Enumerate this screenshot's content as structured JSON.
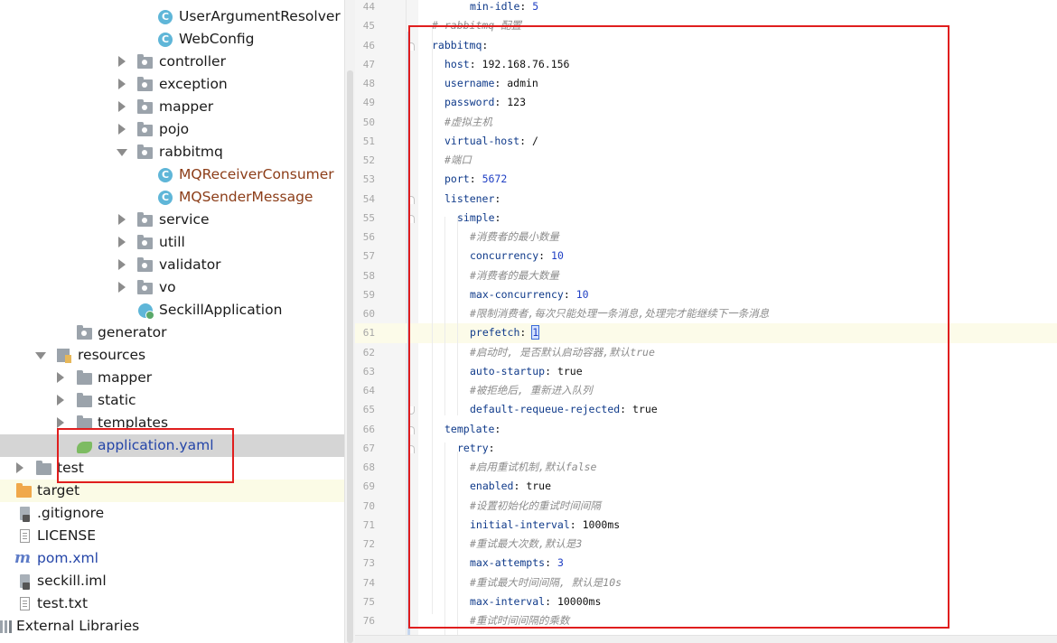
{
  "project_tree": {
    "items": [
      {
        "label": "UserArgumentResolver",
        "icon": "class-icon"
      },
      {
        "label": "WebConfig",
        "icon": "class-icon"
      },
      {
        "label": "controller",
        "icon": "package-folder-icon",
        "expanded": false
      },
      {
        "label": "exception",
        "icon": "package-folder-icon",
        "expanded": false
      },
      {
        "label": "mapper",
        "icon": "package-folder-icon",
        "expanded": false
      },
      {
        "label": "pojo",
        "icon": "package-folder-icon",
        "expanded": false
      },
      {
        "label": "rabbitmq",
        "icon": "package-folder-icon",
        "expanded": true
      },
      {
        "label": "MQReceiverConsumer",
        "icon": "class-icon"
      },
      {
        "label": "MQSenderMessage",
        "icon": "class-icon"
      },
      {
        "label": "service",
        "icon": "package-folder-icon",
        "expanded": false
      },
      {
        "label": "utill",
        "icon": "package-folder-icon",
        "expanded": false
      },
      {
        "label": "validator",
        "icon": "package-folder-icon",
        "expanded": false
      },
      {
        "label": "vo",
        "icon": "package-folder-icon",
        "expanded": false
      },
      {
        "label": "SeckillApplication",
        "icon": "spring-app-icon"
      },
      {
        "label": "generator",
        "icon": "package-folder-icon"
      },
      {
        "label": "resources",
        "icon": "resources-folder-icon",
        "expanded": true
      },
      {
        "label": "mapper",
        "icon": "folder-icon",
        "expanded": false
      },
      {
        "label": "static",
        "icon": "folder-icon",
        "expanded": false
      },
      {
        "label": "templates",
        "icon": "folder-icon",
        "expanded": false
      },
      {
        "label": "application.yaml",
        "icon": "yaml-file-icon",
        "selected": true
      },
      {
        "label": "test",
        "icon": "folder-icon",
        "expanded": false
      },
      {
        "label": "target",
        "icon": "excluded-folder-icon",
        "expanded": false
      },
      {
        "label": ".gitignore",
        "icon": "gitignore-file-icon"
      },
      {
        "label": "LICENSE",
        "icon": "text-file-icon"
      },
      {
        "label": "pom.xml",
        "icon": "maven-icon"
      },
      {
        "label": "seckill.iml",
        "icon": "iml-file-icon"
      },
      {
        "label": "test.txt",
        "icon": "text-file-icon"
      },
      {
        "label": "External Libraries",
        "icon": "libraries-icon"
      }
    ]
  },
  "editor": {
    "file": "application.yaml",
    "current_line": 61,
    "lines": [
      {
        "no": "44",
        "parts": [
          {
            "t": "k",
            "s": "min-idle"
          },
          {
            "t": "v",
            "s": ": "
          },
          {
            "t": "n",
            "s": "5"
          }
        ]
      },
      {
        "no": "45",
        "parts": [
          {
            "t": "c",
            "s": "# rabbitmq 配置"
          }
        ]
      },
      {
        "no": "46",
        "parts": [
          {
            "t": "k",
            "s": "rabbitmq"
          },
          {
            "t": "v",
            "s": ":"
          }
        ]
      },
      {
        "no": "47",
        "parts": [
          {
            "t": "k",
            "s": "host"
          },
          {
            "t": "v",
            "s": ": 192.168.76.156"
          }
        ]
      },
      {
        "no": "48",
        "parts": [
          {
            "t": "k",
            "s": "username"
          },
          {
            "t": "v",
            "s": ": admin"
          }
        ]
      },
      {
        "no": "49",
        "parts": [
          {
            "t": "k",
            "s": "password"
          },
          {
            "t": "v",
            "s": ": "
          },
          {
            "t": "v",
            "s": "123"
          }
        ]
      },
      {
        "no": "50",
        "parts": [
          {
            "t": "c",
            "s": "#虚拟主机"
          }
        ]
      },
      {
        "no": "51",
        "parts": [
          {
            "t": "k",
            "s": "virtual-host"
          },
          {
            "t": "v",
            "s": ": /"
          }
        ]
      },
      {
        "no": "52",
        "parts": [
          {
            "t": "c",
            "s": "#端口"
          }
        ]
      },
      {
        "no": "53",
        "parts": [
          {
            "t": "k",
            "s": "port"
          },
          {
            "t": "v",
            "s": ": "
          },
          {
            "t": "n",
            "s": "5672"
          }
        ]
      },
      {
        "no": "54",
        "parts": [
          {
            "t": "k",
            "s": "listener"
          },
          {
            "t": "v",
            "s": ":"
          }
        ]
      },
      {
        "no": "55",
        "parts": [
          {
            "t": "k",
            "s": "simple"
          },
          {
            "t": "v",
            "s": ":"
          }
        ]
      },
      {
        "no": "56",
        "parts": [
          {
            "t": "c",
            "s": "#消费者的最小数量"
          }
        ]
      },
      {
        "no": "57",
        "parts": [
          {
            "t": "k",
            "s": "concurrency"
          },
          {
            "t": "v",
            "s": ": "
          },
          {
            "t": "n",
            "s": "10"
          }
        ]
      },
      {
        "no": "58",
        "parts": [
          {
            "t": "c",
            "s": "#消费者的最大数量"
          }
        ]
      },
      {
        "no": "59",
        "parts": [
          {
            "t": "k",
            "s": "max-concurrency"
          },
          {
            "t": "v",
            "s": ": "
          },
          {
            "t": "n",
            "s": "10"
          }
        ]
      },
      {
        "no": "60",
        "parts": [
          {
            "t": "c",
            "s": "#限制消费者,每次只能处理一条消息,处理完才能继续下一条消息"
          }
        ]
      },
      {
        "no": "61",
        "parts": [
          {
            "t": "k",
            "s": "prefetch"
          },
          {
            "t": "v",
            "s": ": "
          },
          {
            "t": "caret",
            "s": "1"
          }
        ]
      },
      {
        "no": "62",
        "parts": [
          {
            "t": "c",
            "s": "#启动时, 是否默认启动容器,默认true"
          }
        ]
      },
      {
        "no": "63",
        "parts": [
          {
            "t": "k",
            "s": "auto-startup"
          },
          {
            "t": "v",
            "s": ": true"
          }
        ]
      },
      {
        "no": "64",
        "parts": [
          {
            "t": "c",
            "s": "#被拒绝后, 重新进入队列"
          }
        ]
      },
      {
        "no": "65",
        "parts": [
          {
            "t": "k",
            "s": "default-requeue-rejected"
          },
          {
            "t": "v",
            "s": ": true"
          }
        ]
      },
      {
        "no": "66",
        "parts": [
          {
            "t": "k",
            "s": "template"
          },
          {
            "t": "v",
            "s": ":"
          }
        ]
      },
      {
        "no": "67",
        "parts": [
          {
            "t": "k",
            "s": "retry"
          },
          {
            "t": "v",
            "s": ":"
          }
        ]
      },
      {
        "no": "68",
        "parts": [
          {
            "t": "c",
            "s": "#启用重试机制,默认false"
          }
        ]
      },
      {
        "no": "69",
        "parts": [
          {
            "t": "k",
            "s": "enabled"
          },
          {
            "t": "v",
            "s": ": true"
          }
        ]
      },
      {
        "no": "70",
        "parts": [
          {
            "t": "c",
            "s": "#设置初始化的重试时间间隔"
          }
        ]
      },
      {
        "no": "71",
        "parts": [
          {
            "t": "k",
            "s": "initial-interval"
          },
          {
            "t": "v",
            "s": ": 1000ms"
          }
        ]
      },
      {
        "no": "72",
        "parts": [
          {
            "t": "c",
            "s": "#重试最大次数,默认是3"
          }
        ]
      },
      {
        "no": "73",
        "parts": [
          {
            "t": "k",
            "s": "max-attempts"
          },
          {
            "t": "v",
            "s": ": "
          },
          {
            "t": "n",
            "s": "3"
          }
        ]
      },
      {
        "no": "74",
        "parts": [
          {
            "t": "c",
            "s": "#重试最大时间间隔, 默认是10s"
          }
        ]
      },
      {
        "no": "75",
        "parts": [
          {
            "t": "k",
            "s": "max-interval"
          },
          {
            "t": "v",
            "s": ": 10000ms"
          }
        ]
      },
      {
        "no": "76",
        "parts": [
          {
            "t": "c",
            "s": "#重试时间间隔的乘数"
          }
        ]
      }
    ]
  },
  "colors": {
    "annotation_box": "#e01e1e",
    "selected_row": "#d5d5d5",
    "yaml_key": "#0f3a8a",
    "comment": "#8c8c8c",
    "number": "#1f3fc4"
  }
}
